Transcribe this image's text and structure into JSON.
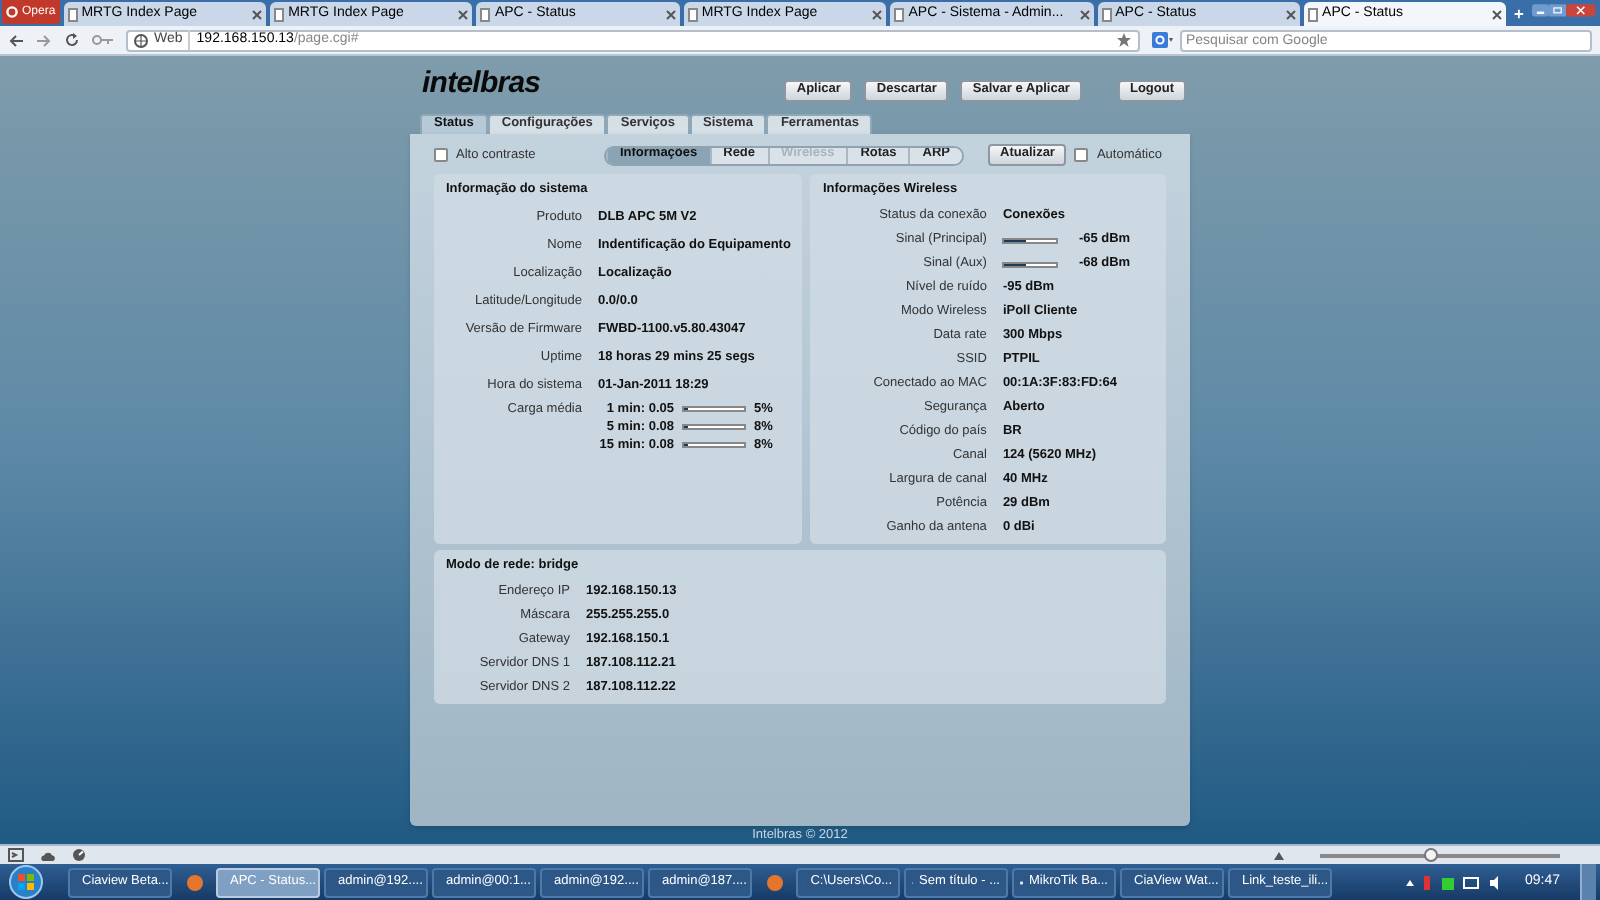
{
  "browser": {
    "menu_button": "Opera",
    "tabs": [
      {
        "label": "MRTG Index Page",
        "selected": false
      },
      {
        "label": "MRTG Index Page",
        "selected": false
      },
      {
        "label": "APC - Status",
        "selected": false
      },
      {
        "label": "MRTG Index Page",
        "selected": false
      },
      {
        "label": "APC - Sistema - Admin...",
        "selected": false
      },
      {
        "label": "APC - Status",
        "selected": false
      },
      {
        "label": "APC - Status",
        "selected": true
      }
    ],
    "address": {
      "site_label": "Web",
      "url_host": "192.168.150.13",
      "url_path": "/page.cgi#"
    },
    "search": {
      "placeholder": "Pesquisar com Google"
    }
  },
  "page": {
    "logo": "intelbras",
    "actions": [
      "Aplicar",
      "Descartar",
      "Salvar e Aplicar"
    ],
    "logout": "Logout",
    "tabs": [
      {
        "label": "Status",
        "selected": true
      },
      {
        "label": "Configurações",
        "selected": false
      },
      {
        "label": "Serviços",
        "selected": false
      },
      {
        "label": "Sistema",
        "selected": false
      },
      {
        "label": "Ferramentas",
        "selected": false
      }
    ],
    "high_contrast": {
      "label": "Alto contraste",
      "checked": false
    },
    "subtabs": [
      {
        "label": "Informações",
        "selected": true,
        "disabled": false
      },
      {
        "label": "Rede",
        "selected": false,
        "disabled": false
      },
      {
        "label": "Wireless",
        "selected": false,
        "disabled": true
      },
      {
        "label": "Rotas",
        "selected": false,
        "disabled": false
      },
      {
        "label": "ARP",
        "selected": false,
        "disabled": false
      }
    ],
    "refresh": "Atualizar",
    "auto": {
      "label": "Automático",
      "checked": false
    },
    "system": {
      "title": "Informação do sistema",
      "rows": [
        {
          "label": "Produto",
          "value": "DLB APC 5M V2"
        },
        {
          "label": "Nome",
          "value": "Indentificação do Equipamento"
        },
        {
          "label": "Localização",
          "value": "Localização"
        },
        {
          "label": "Latitude/Longitude",
          "value": "0.0/0.0"
        },
        {
          "label": "Versão de Firmware",
          "value": "FWBD-1100.v5.80.43047"
        },
        {
          "label": "Uptime",
          "value": "18 horas 29 mins 25 segs"
        },
        {
          "label": "Hora do sistema",
          "value": "01-Jan-2011 18:29"
        }
      ],
      "load": {
        "label": "Carga média",
        "items": [
          {
            "label": "1 min: 0.05",
            "level": 0.05,
            "percent": "5%"
          },
          {
            "label": "5 min: 0.08",
            "level": 0.08,
            "percent": "8%"
          },
          {
            "label": "15 min: 0.08",
            "level": 0.08,
            "percent": "8%"
          }
        ]
      }
    },
    "wireless": {
      "title": "Informações Wireless",
      "rows": [
        {
          "kind": "text",
          "label": "Status da conexão",
          "value": "Conexões"
        },
        {
          "kind": "meter",
          "label": "Sinal (Principal)",
          "level": 0.4,
          "value": "-65 dBm"
        },
        {
          "kind": "meter",
          "label": "Sinal (Aux)",
          "level": 0.4,
          "value": "-68 dBm"
        },
        {
          "kind": "text",
          "label": "Nível de ruído",
          "value": "-95 dBm"
        },
        {
          "kind": "text",
          "label": "Modo Wireless",
          "value": "iPoll Cliente"
        },
        {
          "kind": "text",
          "label": "Data rate",
          "value": "300 Mbps"
        },
        {
          "kind": "text",
          "label": "SSID",
          "value": "PTPIL"
        },
        {
          "kind": "text",
          "label": "Conectado ao MAC",
          "value": "00:1A:3F:83:FD:64"
        },
        {
          "kind": "text",
          "label": "Segurança",
          "value": "Aberto"
        },
        {
          "kind": "text",
          "label": "Código do país",
          "value": "BR"
        },
        {
          "kind": "text",
          "label": "Canal",
          "value": "124 (5620 MHz)"
        },
        {
          "kind": "text",
          "label": "Largura de canal",
          "value": "40 MHz"
        },
        {
          "kind": "text",
          "label": "Potência",
          "value": "29 dBm"
        },
        {
          "kind": "text",
          "label": "Ganho da antena",
          "value": "0 dBi"
        }
      ]
    },
    "network": {
      "title": "Modo de rede: bridge",
      "rows": [
        {
          "label": "Endereço IP",
          "value": "192.168.150.13"
        },
        {
          "label": "Máscara",
          "value": "255.255.255.0"
        },
        {
          "label": "Gateway",
          "value": "192.168.150.1"
        },
        {
          "label": "Servidor DNS 1",
          "value": "187.108.112.21"
        },
        {
          "label": "Servidor DNS 2",
          "value": "187.108.112.22"
        }
      ]
    },
    "footer": "Intelbras © 2012"
  },
  "status_bar": {
    "zoom": {
      "level": 0.46
    }
  },
  "taskbar": {
    "items": [
      {
        "kind": "button",
        "label": "Ciaview Beta...",
        "selected": false
      },
      {
        "kind": "icon",
        "selected": false
      },
      {
        "kind": "button",
        "label": "APC - Status...",
        "selected": true
      },
      {
        "kind": "button",
        "label": "admin@192....",
        "selected": false
      },
      {
        "kind": "button",
        "label": "admin@00:1...",
        "selected": false
      },
      {
        "kind": "button",
        "label": "admin@192....",
        "selected": false
      },
      {
        "kind": "button",
        "label": "admin@187....",
        "selected": false
      },
      {
        "kind": "icon",
        "selected": false
      },
      {
        "kind": "button",
        "label": "C:\\Users\\Co...",
        "selected": false
      },
      {
        "kind": "button",
        "label": "Sem título - ...",
        "selected": false
      },
      {
        "kind": "button",
        "label": "MikroTik Ba...",
        "selected": false
      },
      {
        "kind": "button",
        "label": "CiaView Wat...",
        "selected": false
      },
      {
        "kind": "button",
        "label": "Link_teste_ili...",
        "selected": false
      }
    ],
    "clock": "09:47"
  }
}
